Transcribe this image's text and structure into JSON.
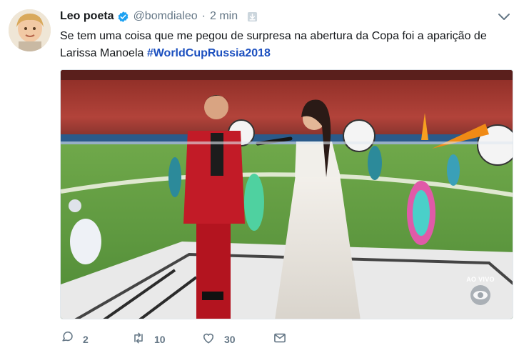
{
  "tweet": {
    "author": {
      "display_name": "Leo poeta",
      "handle": "@bomdialeo",
      "verified": true
    },
    "separator": "·",
    "time": "2 min",
    "text": "Se tem uma coisa que me pegou de surpresa na abertura da Copa foi a aparição de Larissa Manoela ",
    "hashtag": "#WorldCupRussia2018",
    "media": {
      "live_label": "AO VIVO",
      "watermark_icon": "globo-logo"
    },
    "actions": {
      "reply_count": "2",
      "retweet_count": "10",
      "like_count": "30"
    }
  },
  "icons": {
    "verified": "verified-badge-icon",
    "download": "download-icon",
    "caret": "chevron-down-icon",
    "reply": "reply-icon",
    "retweet": "retweet-icon",
    "like": "heart-icon",
    "message": "envelope-icon"
  },
  "colors": {
    "accent": "#1da1f2",
    "hashtag": "#1b4fbf",
    "muted": "#657786",
    "text": "#14171a"
  }
}
